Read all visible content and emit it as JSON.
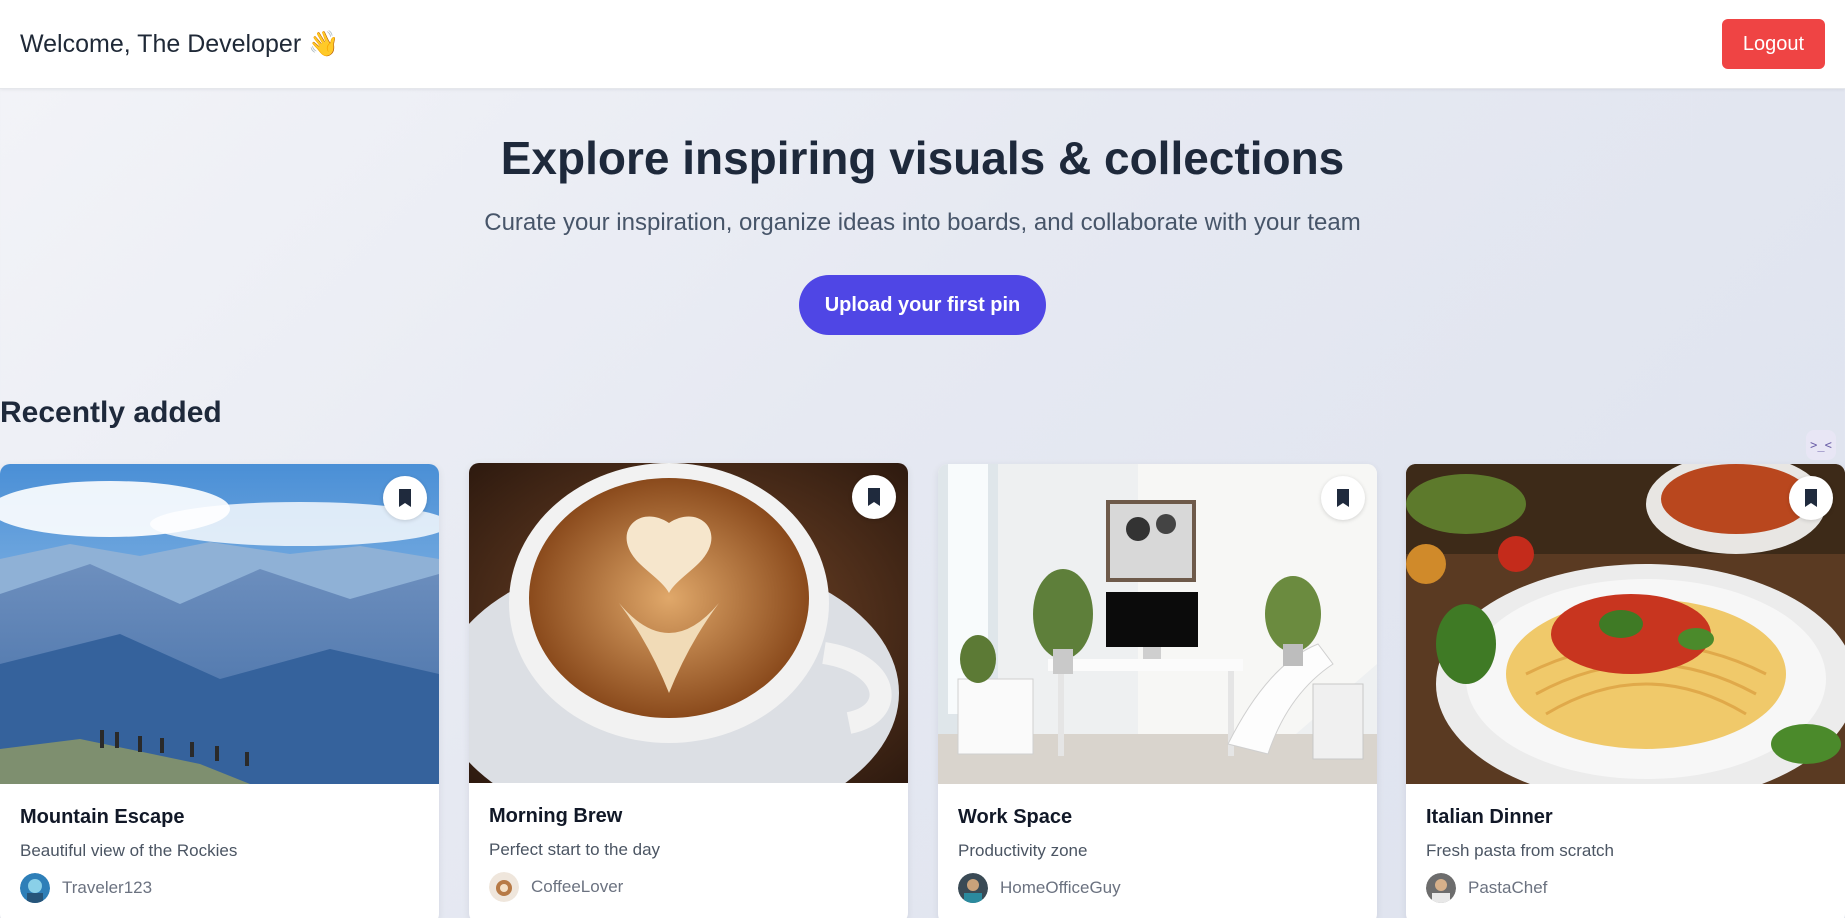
{
  "header": {
    "welcome": "Welcome, The Developer 👋",
    "logout_label": "Logout"
  },
  "hero": {
    "title": "Explore inspiring visuals & collections",
    "subtitle": "Curate your inspiration, organize ideas into boards, and collaborate with your team",
    "cta_label": "Upload your first pin"
  },
  "section": {
    "title": "Recently added"
  },
  "side_bubble": {
    "glyph": ">_<"
  },
  "pins": [
    {
      "title": "Mountain Escape",
      "description": "Beautiful view of the Rockies",
      "author": "Traveler123",
      "image": "mountain-landscape-image"
    },
    {
      "title": "Morning Brew",
      "description": "Perfect start to the day",
      "author": "CoffeeLover",
      "image": "latte-art-image"
    },
    {
      "title": "Work Space",
      "description": "Productivity zone",
      "author": "HomeOfficeGuy",
      "image": "home-office-image"
    },
    {
      "title": "Italian Dinner",
      "description": "Fresh pasta from scratch",
      "author": "PastaChef",
      "image": "spaghetti-plate-image"
    }
  ],
  "icons": {
    "bookmark": "bookmark-icon"
  },
  "colors": {
    "logout": "#ef4444",
    "cta": "#4f46e5",
    "text_dark": "#1e293b"
  }
}
